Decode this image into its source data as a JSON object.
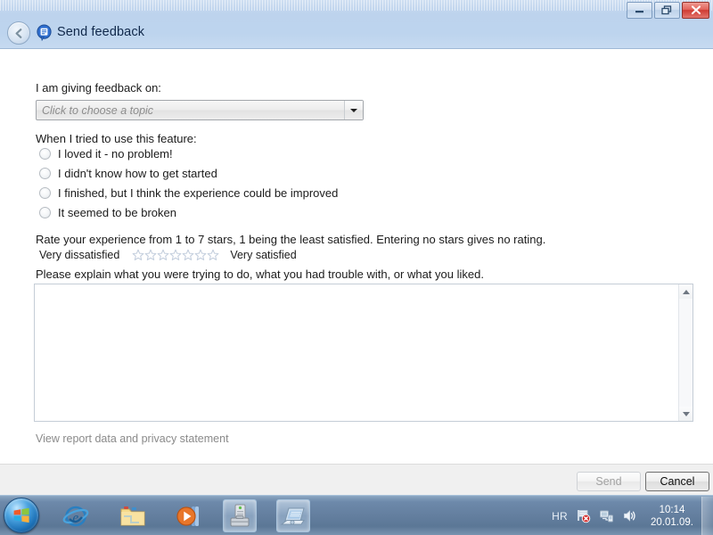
{
  "window": {
    "title": "Send feedback",
    "icon": "feedback-bubble-icon",
    "back_button": "back-arrow",
    "controls": {
      "minimize": "minimize",
      "restore": "restore",
      "close": "close"
    }
  },
  "form": {
    "topic_label": "I am giving feedback on:",
    "topic_placeholder": "Click to choose a topic",
    "topic_value": "",
    "experience_label": "When I tried to use this feature:",
    "radio_options": [
      {
        "label": "I loved it - no problem!",
        "selected": false
      },
      {
        "label": "I didn't know how to get started",
        "selected": false
      },
      {
        "label": "I finished, but I think the experience could be improved",
        "selected": false
      },
      {
        "label": "It seemed to be broken",
        "selected": false
      }
    ],
    "rating_instructions": "Rate your experience from 1 to 7 stars, 1 being the least satisfied.  Entering no stars gives no rating.",
    "rating_low_label": "Very dissatisfied",
    "rating_high_label": "Very satisfied",
    "stars_total": 7,
    "stars_selected": 0,
    "comment_label": "Please explain what you were trying to do, what you had trouble with, or what you liked.",
    "comment_value": "",
    "privacy_link": "View report data and privacy statement"
  },
  "footer": {
    "send_label": "Send",
    "send_enabled": false,
    "cancel_label": "Cancel",
    "cancel_enabled": true
  },
  "taskbar": {
    "start_button": "windows-start-orb",
    "pinned": [
      {
        "name": "internet-explorer-icon"
      },
      {
        "name": "windows-explorer-folder-icon"
      },
      {
        "name": "windows-media-player-icon"
      }
    ],
    "windows": [
      {
        "name": "computer-toolbox-window",
        "active": true
      },
      {
        "name": "feedback-tool-window",
        "active": true
      }
    ],
    "tray": {
      "language": "HR",
      "icons": [
        "action-center-flag-icon",
        "network-icon",
        "volume-icon"
      ],
      "time": "10:14",
      "date": "20.01.09."
    }
  },
  "colors": {
    "titlebar": "#bdd3ed",
    "taskbar": "#647f9f",
    "close_button": "#cf3b32",
    "accent_blue": "#1b6fb5",
    "star_outline": "#c3cedd",
    "link_gray": "#8a8a8a"
  }
}
